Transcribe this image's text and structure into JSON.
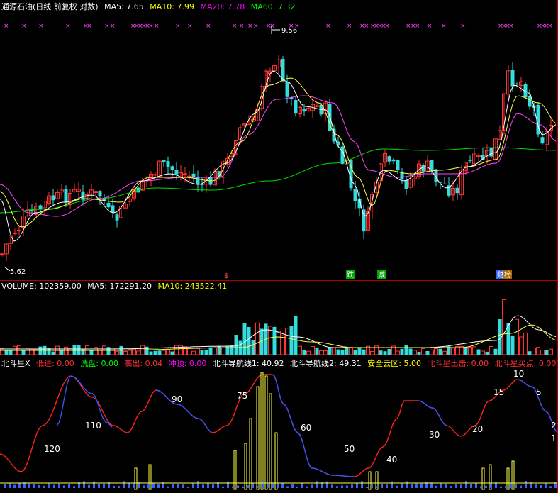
{
  "header": {
    "title": "通源石油(日线 前复权 对数)",
    "ma": [
      {
        "label": "MA5: 7.65",
        "color": "#ffffff"
      },
      {
        "label": "MA10: 7.99",
        "color": "#ffff00"
      },
      {
        "label": "MA20: 7.78",
        "color": "#ff00ff"
      },
      {
        "label": "MA60: 7.32",
        "color": "#00ff00"
      }
    ]
  },
  "price_panel": {
    "high_label": "9.56",
    "low_label": "5.62",
    "signals": [
      {
        "text": "跌",
        "color": "#00aa00"
      },
      {
        "text": "减",
        "color": "#00aa00"
      },
      {
        "text": "财",
        "color": "#3366ff"
      },
      {
        "text": "榜",
        "color": "#aa6600"
      }
    ],
    "marker": "$"
  },
  "volume_panel": {
    "labels": [
      {
        "text": "VOLUME: 102359.00",
        "color": "#ffffff"
      },
      {
        "text": "MA5: 172291.20",
        "color": "#ffffff"
      },
      {
        "text": "MA10: 243522.41",
        "color": "#ffff00"
      }
    ]
  },
  "indicator_panel": {
    "labels": [
      {
        "text": "北斗星X",
        "color": "#ffffff"
      },
      {
        "text": "低进: 0.00",
        "color": "#ff3030"
      },
      {
        "text": "洗盘: 0.00",
        "color": "#00ff00"
      },
      {
        "text": "高出: 0.04",
        "color": "#ff3030"
      },
      {
        "text": "冲顶: 0.00",
        "color": "#ff00ff"
      },
      {
        "text": "北斗导航线1: 40.92",
        "color": "#ffffff"
      },
      {
        "text": "北斗导航线2: 49.31",
        "color": "#ffffff"
      },
      {
        "text": "安全云区: 5.00",
        "color": "#ffff00"
      },
      {
        "text": "北斗星出击: 0.00",
        "color": "#ff3030"
      },
      {
        "text": "北斗星买点: 0.00",
        "color": "#ff3030"
      }
    ],
    "curve_labels": [
      "120",
      "110",
      "90",
      "75",
      "60",
      "50",
      "40",
      "30",
      "20",
      "15",
      "10",
      "5",
      "2",
      "1"
    ]
  },
  "chart_data": {
    "type": "candlestick",
    "price": {
      "scale": "log",
      "high": 9.56,
      "low": 5.62,
      "series": [
        {
          "name": "MA5",
          "value": 7.65
        },
        {
          "name": "MA10",
          "value": 7.99
        },
        {
          "name": "MA20",
          "value": 7.78
        },
        {
          "name": "MA60",
          "value": 7.32
        }
      ]
    },
    "volume": {
      "last": 102359.0,
      "series": [
        {
          "name": "MA5",
          "value": 172291.2
        },
        {
          "name": "MA10",
          "value": 243522.41
        }
      ]
    },
    "indicator": {
      "name": "北斗星X",
      "values": {
        "低进": 0.0,
        "洗盘": 0.0,
        "高出": 0.04,
        "冲顶": 0.0,
        "北斗导航线1": 40.92,
        "北斗导航线2": 49.31,
        "安全云区": 5.0,
        "北斗星出击": 0.0,
        "北斗星买点": 0.0
      }
    }
  }
}
